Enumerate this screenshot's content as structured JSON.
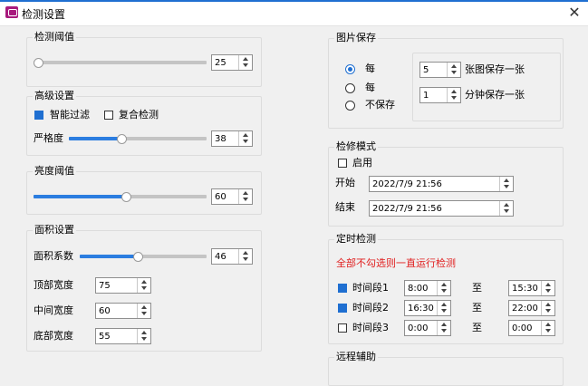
{
  "window": {
    "title": "检测设置"
  },
  "detect_threshold": {
    "title": "检测阈值",
    "slider": 0.0,
    "value": "25"
  },
  "advanced": {
    "title": "高级设置",
    "smart_filter": {
      "label": "智能过滤",
      "checked": true
    },
    "composite_detect": {
      "label": "复合检测",
      "checked": false
    },
    "strictness": {
      "label": "严格度",
      "slider": 0.38,
      "value": "38"
    }
  },
  "brightness": {
    "title": "亮度阈值",
    "slider": 0.6,
    "value": "60"
  },
  "area": {
    "title": "面积设置",
    "coef": {
      "label": "面积系数",
      "slider": 0.46,
      "value": "46"
    },
    "top_width": {
      "label": "顶部宽度",
      "value": "75"
    },
    "mid_width": {
      "label": "中间宽度",
      "value": "60"
    },
    "bottom_width": {
      "label": "底部宽度",
      "value": "55"
    }
  },
  "image_save": {
    "title": "图片保存",
    "options": [
      {
        "label": "每",
        "selected": true
      },
      {
        "label": "每",
        "selected": false
      },
      {
        "label": "不保存",
        "selected": false
      }
    ],
    "per_image": {
      "value": "5",
      "suffix": "张图保存一张"
    },
    "per_minute": {
      "value": "1",
      "suffix": "分钟保存一张"
    }
  },
  "maintenance": {
    "title": "检修模式",
    "enable": {
      "label": "启用",
      "checked": false
    },
    "start": {
      "label": "开始",
      "value": "2022/7/9 21:56"
    },
    "end": {
      "label": "结束",
      "value": "2022/7/9 21:56"
    }
  },
  "schedule": {
    "title": "定时检测",
    "note": "全部不勾选则一直运行检测",
    "to_label": "至",
    "periods": [
      {
        "label": "时间段1",
        "checked": true,
        "start": "8:00",
        "end": "15:30"
      },
      {
        "label": "时间段2",
        "checked": true,
        "start": "16:30",
        "end": "22:00"
      },
      {
        "label": "时间段3",
        "checked": false,
        "start": "0:00",
        "end": "0:00"
      }
    ]
  },
  "remote": {
    "title": "远程辅助"
  },
  "colors": {
    "accent": "#1f6fd1",
    "warning": "#e02020",
    "app_icon": "#a8197d"
  }
}
